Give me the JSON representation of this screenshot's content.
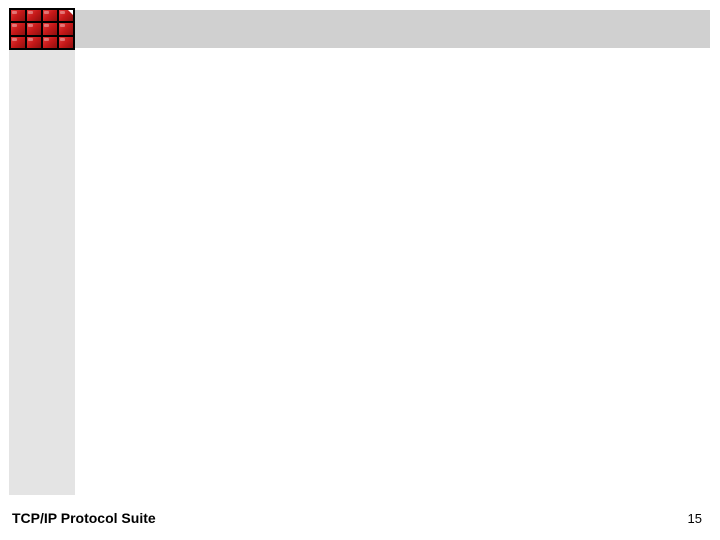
{
  "footer": {
    "title": "TCP/IP Protocol Suite",
    "page_number": "15"
  }
}
